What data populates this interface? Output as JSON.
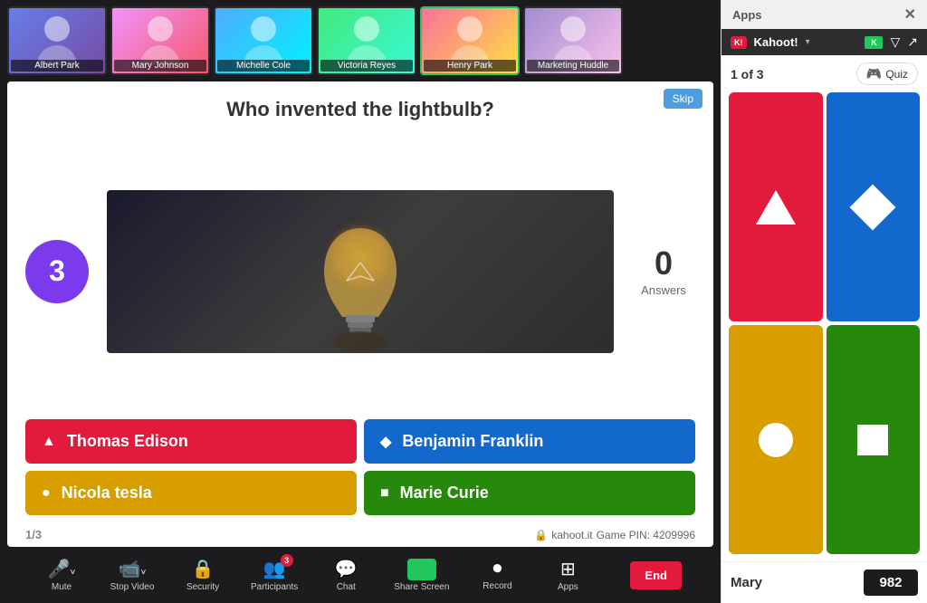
{
  "window": {
    "title": "Apps"
  },
  "participants": [
    {
      "name": "Albert Park",
      "avatarClass": "avatar-1",
      "active": false
    },
    {
      "name": "Mary Johnson",
      "avatarClass": "avatar-2",
      "active": false
    },
    {
      "name": "Michelle Cole",
      "avatarClass": "avatar-3",
      "active": false
    },
    {
      "name": "Victoria Reyes",
      "avatarClass": "avatar-4",
      "active": false
    },
    {
      "name": "Henry Park",
      "avatarClass": "avatar-5",
      "active": true
    },
    {
      "name": "Marketing Huddle",
      "avatarClass": "avatar-6",
      "active": false
    }
  ],
  "kahoot": {
    "question": "Who invented the lightbulb?",
    "timer": "3",
    "skip_label": "Skip",
    "answers_count": "0",
    "answers_label": "Answers",
    "answers": [
      {
        "text": "Thomas Edison",
        "color": "red",
        "shape": "triangle"
      },
      {
        "text": "Benjamin Franklin",
        "color": "blue",
        "shape": "diamond"
      },
      {
        "text": "Nicola tesla",
        "color": "yellow",
        "shape": "circle"
      },
      {
        "text": "Marie Curie",
        "color": "green",
        "shape": "square"
      }
    ],
    "progress": "1/3",
    "game_pin_label": "kahoot.it",
    "game_pin": "Game PIN: 4209996"
  },
  "sidebar": {
    "header_title": "Apps",
    "kahoot_name": "Kahoot!",
    "quiz_counter": "1 of 3",
    "quiz_label": "Quiz",
    "score_player": "Mary",
    "score_value": "982"
  },
  "toolbar": {
    "items": [
      {
        "label": "Mute",
        "icon": "🎤",
        "active": false
      },
      {
        "label": "Stop Video",
        "icon": "📹",
        "active": false
      },
      {
        "label": "Security",
        "icon": "🔒",
        "active": false
      },
      {
        "label": "Participants",
        "icon": "👥",
        "active": false,
        "badge": "3"
      },
      {
        "label": "Chat",
        "icon": "💬",
        "active": false
      },
      {
        "label": "Share Screen",
        "icon": "🖥",
        "active": true
      },
      {
        "label": "Record",
        "icon": "⏺",
        "active": false
      },
      {
        "label": "Apps",
        "icon": "⊞",
        "active": false
      }
    ],
    "end_label": "End"
  }
}
